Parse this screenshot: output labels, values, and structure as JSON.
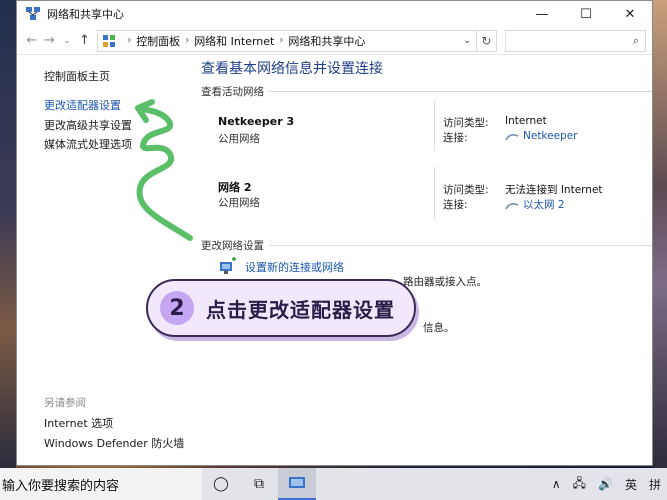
{
  "window": {
    "title": "网络和共享中心",
    "controls": {
      "minimize": "—",
      "maximize": "☐",
      "close": "✕"
    }
  },
  "address": {
    "back": "←",
    "forward": "→",
    "dropdown": "⌄",
    "up": "↑",
    "crumbs": [
      "控制面板",
      "网络和 Internet",
      "网络和共享中心"
    ],
    "separator": "›",
    "dropdown_arrow": "⌄",
    "refresh": "↻",
    "search_placeholder": "",
    "search_icon": "⌕"
  },
  "sidebar": {
    "home": "控制面板主页",
    "links": [
      "更改适配器设置",
      "更改高级共享设置",
      "媒体流式处理选项"
    ],
    "see_also_label": "另请参阅",
    "see_also": [
      "Internet 选项",
      "Windows Defender 防火墙"
    ]
  },
  "main": {
    "title": "查看基本网络信息并设置连接",
    "active_label": "查看活动网络",
    "networks": [
      {
        "name": "Netkeeper 3",
        "type": "公用网络",
        "access_label": "访问类型:",
        "access": "Internet",
        "conn_label": "连接:",
        "conn": "Netkeeper"
      },
      {
        "name": "网络 2",
        "type": "公用网络",
        "access_label": "访问类型:",
        "access": "无法连接到 Internet",
        "conn_label": "连接:",
        "conn": "以太网 2"
      }
    ],
    "change_label": "更改网络设置",
    "tasks": [
      {
        "link": "设置新的连接或网络",
        "desc": "路由器或接入点。"
      },
      {
        "desc": "信息。"
      }
    ]
  },
  "overlay": {
    "number": "2",
    "text": "点击更改适配器设置",
    "accent": "#c4a6f2",
    "arrow_color": "#5bbf6a"
  },
  "taskbar": {
    "search_text": "输入你要搜索的内容",
    "cortana": "◯",
    "task_view": "⧉",
    "tray": {
      "up": "∧",
      "network": "🖧",
      "volume": "🔊",
      "lang": "英",
      "ime": "拼"
    }
  }
}
